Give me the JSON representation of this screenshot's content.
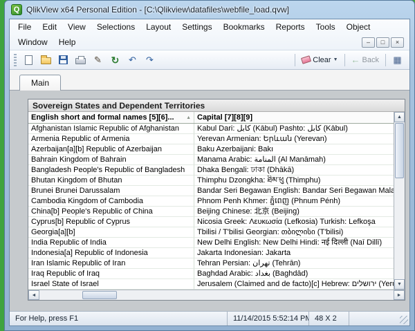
{
  "window": {
    "title": "QlikView x64 Personal Edition - [C:\\Qlikview\\datafiles\\webfile_load.qvw]",
    "app_icon_letter": "Q",
    "mdi": {
      "minimize": "–",
      "restore": "□",
      "close": "×"
    }
  },
  "menu": {
    "row1": [
      "File",
      "Edit",
      "View",
      "Selections",
      "Layout",
      "Settings",
      "Bookmarks",
      "Reports",
      "Tools",
      "Object"
    ],
    "row2": [
      "Window",
      "Help"
    ]
  },
  "toolbar": {
    "icons": [
      "new",
      "open",
      "save",
      "print",
      "edit-script",
      "reload",
      "undo",
      "redo"
    ],
    "icon_glyphs": {
      "edit-script": "✎",
      "reload": "↻",
      "undo": "↶",
      "redo": "↷"
    },
    "clear_label": "Clear",
    "clear_caret": "▼",
    "back_label": "Back",
    "back_arrow": "←",
    "grid_glyph": "▦"
  },
  "tabs": [
    {
      "label": "Main"
    }
  ],
  "table": {
    "caption": "Sovereign States and Dependent Territories",
    "columns": [
      "English short and formal names [5][6]...",
      "Capital [7][8][9]"
    ],
    "sort_glyph": "▲",
    "rows": [
      [
        "Afghanistan Islamic Republic of Afghanistan",
        "Kabul Dari: كابل (Kābul) Pashto: كابل (Kābul)"
      ],
      [
        "Armenia Republic of Armenia",
        "Yerevan Armenian: Երևան (Yerevan)"
      ],
      [
        "Azerbaijan[a][b] Republic of Azerbaijan",
        "Baku Azerbaijani: Bakı"
      ],
      [
        "Bahrain Kingdom of Bahrain",
        "Manama Arabic: المنامة (Al Manāmah)"
      ],
      [
        "Bangladesh People's Republic of Bangladesh",
        "Dhaka Bengali: ঢাকা (Dhākā)"
      ],
      [
        "Bhutan Kingdom of Bhutan",
        "Thimphu Dzongkha: ཐིམ་ཕུ (Thimphu)"
      ],
      [
        "Brunei Brunei Darussalam",
        "Bandar Seri Begawan English: Bandar Seri Begawan Malay: B..."
      ],
      [
        "Cambodia Kingdom of Cambodia",
        "Phnom Penh Khmer: ភ្នំពេញ (Phnum Pénh)"
      ],
      [
        "China[b] People's Republic of China",
        "Beijing Chinese: 北京 (Beijing)"
      ],
      [
        "Cyprus[b] Republic of Cyprus",
        "Nicosia Greek: Λευκωσία (Lefkosia) Turkish: Lefkoşa"
      ],
      [
        "Georgia[a][b]",
        "Tbilisi / T'bilisi Georgian: თბილისი (T'bilisi)"
      ],
      [
        "India Republic of India",
        "New Delhi English: New Delhi Hindi: नई दिल्ली (Naī Dillī)"
      ],
      [
        "Indonesia[a] Republic of Indonesia",
        "Jakarta Indonesian: Jakarta"
      ],
      [
        "Iran Islamic Republic of Iran",
        "Tehran Persian: تهران (Tehrān)"
      ],
      [
        "Iraq Republic of Iraq",
        "Baghdad Arabic: بغداد (Baghdād)"
      ],
      [
        "Israel State of Israel",
        "Jerusalem (Claimed and de facto)[c] Hebrew: ירושלים (Yeru..."
      ]
    ]
  },
  "scrollbars": {
    "up": "▲",
    "down": "▼",
    "left": "◄",
    "right": "►"
  },
  "statusbar": {
    "help": "For Help, press F1",
    "timestamp": "11/14/2015 5:52:14 PM",
    "dims": "48 X 2"
  }
}
